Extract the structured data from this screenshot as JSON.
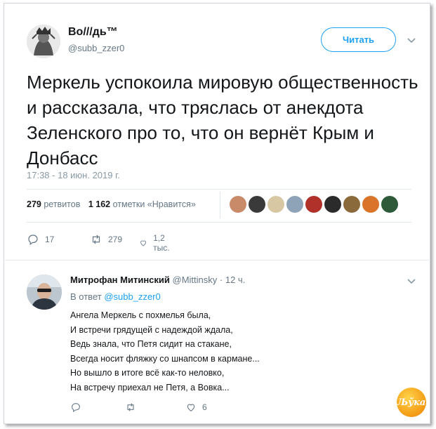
{
  "tweet": {
    "author": {
      "name": "Во///дь™",
      "handle": "@subb_zzer0"
    },
    "follow_label": "Читать",
    "text": "Меркель успокоила мировую общественность и рассказала, что тряслась от анекдота Зеленского про то, что он вернёт Крым и Донбасс",
    "timestamp": "17:38 - 18 июн. 2019 г.",
    "stats": {
      "retweets_count": "279",
      "retweets_label": "ретвитов",
      "likes_count": "1 162",
      "likes_label": "отметки «Нравится»"
    },
    "liker_avatars": [
      {
        "icon": "avatar-1",
        "color": "#c98a6a"
      },
      {
        "icon": "avatar-2",
        "color": "#3a3a3a"
      },
      {
        "icon": "avatar-3",
        "color": "#d8c7a3"
      },
      {
        "icon": "avatar-4",
        "color": "#8fa3b8"
      },
      {
        "icon": "avatar-5",
        "color": "#b0302a"
      },
      {
        "icon": "avatar-6",
        "color": "#2b2b2b"
      },
      {
        "icon": "avatar-7",
        "color": "#8a6a3a"
      },
      {
        "icon": "avatar-8",
        "color": "#d9742a"
      },
      {
        "icon": "avatar-9",
        "color": "#2f5a3a"
      }
    ],
    "actions": {
      "replies": "17",
      "retweets": "279",
      "likes": "1,2 тыс."
    }
  },
  "reply": {
    "author": {
      "name": "Митрофан Митинский",
      "handle": "@Mittinsky",
      "time": "· 12 ч."
    },
    "reply_to_label": "В ответ",
    "reply_to_handle": "@subb_zzer0",
    "lines": [
      "Ангела Меркель с похмелья была,",
      "И встречи грядущей с надеждой ждала,",
      "Ведь знала, что Петя сидит на стакане,",
      "Всегда носит фляжку со шнапсом в кармане...",
      "Но вышло в итоге всё как-то неловко,",
      "На встречу приехал не Петя, а Вовка..."
    ],
    "actions": {
      "likes": "6"
    }
  },
  "watermark": {
    "text": "Љўка",
    "icon": "watermark-logo"
  },
  "colors": {
    "accent": "#1da1f2",
    "text": "#14171a",
    "muted": "#657786",
    "border": "#e1e8ed"
  }
}
